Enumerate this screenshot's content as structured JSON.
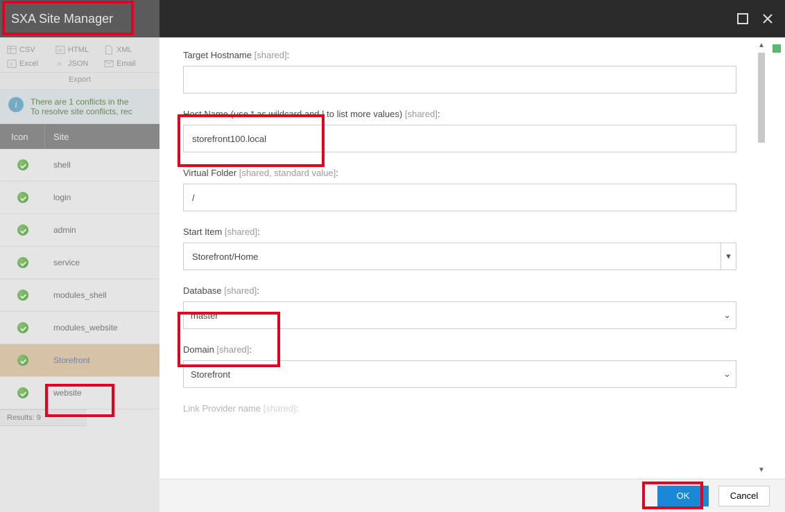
{
  "title": "SXA Site Manager",
  "export": {
    "items": [
      "CSV",
      "HTML",
      "XML",
      "Excel",
      "JSON",
      "Email"
    ],
    "label": "Export"
  },
  "infobar": {
    "line1": "There are 1 conflicts in the",
    "line2": "To resolve site conflicts, rec"
  },
  "table": {
    "col_icon": "Icon",
    "col_site": "Site",
    "sites": [
      "shell",
      "login",
      "admin",
      "service",
      "modules_shell",
      "modules_website",
      "Storefront",
      "website"
    ],
    "selected_index": 6
  },
  "results": "Results: 9",
  "form": {
    "target_hostname": {
      "label": "Target Hostname",
      "meta": "[shared]",
      "value": ""
    },
    "hostname": {
      "label": "Host Name (use * as wildcard and | to list more values)",
      "meta": "[shared]",
      "value": "storefront100.local"
    },
    "virtual_folder": {
      "label": "Virtual Folder",
      "meta": "[shared, standard value]",
      "value": "/"
    },
    "start_item": {
      "label": "Start Item",
      "meta": "[shared]",
      "value": "Storefront/Home"
    },
    "database": {
      "label": "Database",
      "meta": "[shared]",
      "value": "master"
    },
    "domain": {
      "label": "Domain",
      "meta": "[shared]",
      "value": "Storefront"
    },
    "link_provider": {
      "label": "Link Provider name",
      "meta": "[shared]"
    }
  },
  "footer": {
    "ok": "OK",
    "cancel": "Cancel"
  }
}
